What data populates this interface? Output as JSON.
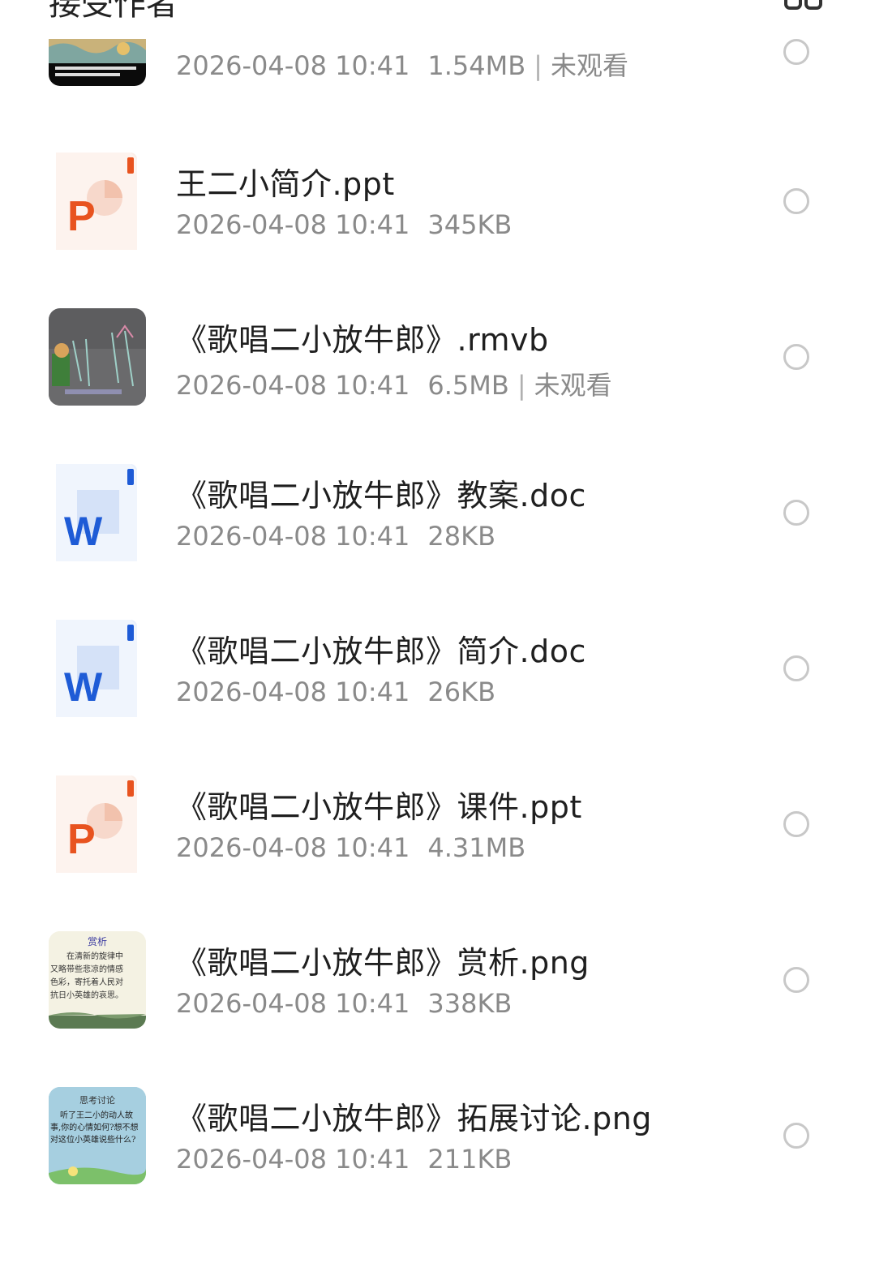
{
  "header": {
    "title": "接受作者"
  },
  "files": [
    {
      "name": "",
      "date": "2026-04-08 10:41",
      "size": "1.54MB",
      "status": "未观看",
      "icon": "video-thumbnail-icon"
    },
    {
      "name": "王二小简介.ppt",
      "date": "2026-04-08 10:41",
      "size": "345KB",
      "status": "",
      "icon": "ppt-file-icon"
    },
    {
      "name": "《歌唱二小放牛郎》.rmvb",
      "date": "2026-04-08 10:41",
      "size": "6.5MB",
      "status": "未观看",
      "icon": "video-thumbnail-icon"
    },
    {
      "name": "《歌唱二小放牛郎》教案.doc",
      "date": "2026-04-08 10:41",
      "size": "28KB",
      "status": "",
      "icon": "word-file-icon"
    },
    {
      "name": "《歌唱二小放牛郎》简介.doc",
      "date": "2026-04-08 10:41",
      "size": "26KB",
      "status": "",
      "icon": "word-file-icon"
    },
    {
      "name": "《歌唱二小放牛郎》课件.ppt",
      "date": "2026-04-08 10:41",
      "size": "4.31MB",
      "status": "",
      "icon": "ppt-file-icon"
    },
    {
      "name": "《歌唱二小放牛郎》赏析.png",
      "date": "2026-04-08 10:41",
      "size": "338KB",
      "status": "",
      "icon": "image-thumbnail-icon",
      "thumb_title": "赏析",
      "thumb_lines": [
        "在清新的旋律中",
        "又略带些悲凉的情感",
        "色彩，寄托着人民对",
        "抗日小英雄的哀思。"
      ]
    },
    {
      "name": "《歌唱二小放牛郎》拓展讨论.png",
      "date": "2026-04-08 10:41",
      "size": "211KB",
      "status": "",
      "icon": "image-thumbnail-icon",
      "thumb_title": "思考讨论",
      "thumb_lines": [
        "听了王二小的动人故",
        "事,你的心情如何?想不想",
        "对这位小英雄说些什么?"
      ]
    }
  ],
  "colors": {
    "ppt": "#E8531F",
    "word": "#1E5BD6",
    "text_primary": "#1f1f1f",
    "text_secondary": "#8a8a8a",
    "radio_border": "#c8c8c8"
  }
}
